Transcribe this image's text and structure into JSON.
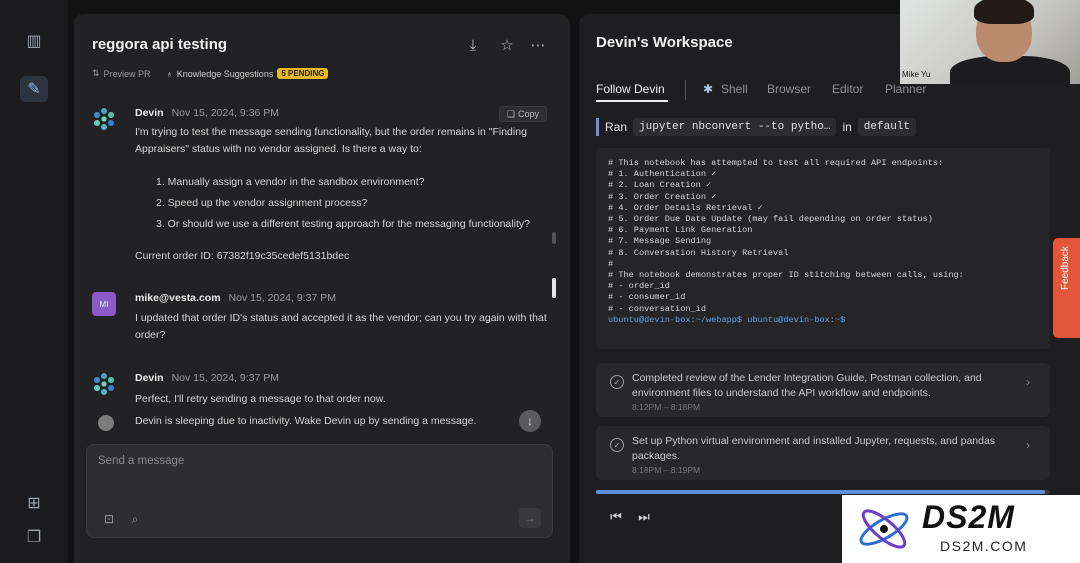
{
  "chat": {
    "title": "reggora api testing",
    "preview_pr": "Preview PR",
    "knowledge": "Knowledge Suggestions",
    "pending": "5 PENDING",
    "copy": "Copy",
    "messages": [
      {
        "name": "Devin",
        "date": "Nov 15, 2024, 9:36 PM",
        "text": "I'm trying to test the message sending functionality, but the order remains in \"Finding Appraisers\" status with no vendor assigned. Is there a way to:",
        "list": [
          "1.  Manually assign a vendor in the sandbox environment?",
          "2.  Speed up the vendor assignment process?",
          "3.  Or should we use a different testing approach for the messaging functionality?"
        ],
        "order": "Current order ID: 67382f19c35cedef5131bdec"
      },
      {
        "avatar": "MI",
        "name": "mike@vesta.com",
        "date": "Nov 15, 2024, 9:37 PM",
        "text": "I updated that order ID's status and accepted it as the vendor; can you try again with that order?"
      },
      {
        "name": "Devin",
        "date": "Nov 15, 2024, 9:37 PM",
        "text": "Perfect, I'll retry sending a message to that order now."
      }
    ],
    "sleeping": "Devin is sleeping due to inactivity. Wake Devin up by sending a message.",
    "input_placeholder": "Send a message"
  },
  "workspace": {
    "title": "Devin's Workspace",
    "tabs": [
      "Follow Devin",
      "Shell",
      "Browser",
      "Editor",
      "Planner"
    ],
    "ran": {
      "prefix": "Ran",
      "command": "jupyter nbconvert --to pytho…",
      "suffix": "in",
      "env": "default"
    },
    "terminal": {
      "lines": [
        "# This notebook has attempted to test all required API endpoints:",
        "# 1. Authentication ✓",
        "# 2. Loan Creation ✓",
        "# 3. Order Creation ✓",
        "# 4. Order Details Retrieval ✓",
        "# 5. Order Due Date Update (may fail depending on order status)",
        "# 6. Payment Link Generation",
        "# 7. Message Sending",
        "# 8. Conversation History Retrieval",
        "#",
        "# The notebook demonstrates proper ID stitching between calls, using:",
        "# - order_id",
        "# - consumer_id",
        "# - conversation_id"
      ],
      "prompt": "ubuntu@devin-box:~/webapp$ ubuntu@devin-box:~$"
    },
    "steps": [
      {
        "text": "Completed review of the Lender Integration Guide, Postman collection, and environment files to understand the API workflow and endpoints.",
        "time": "8:12PM – 8:18PM"
      },
      {
        "text": "Set up Python virtual environment and installed Jupyter, requests, and pandas packages.",
        "time": "8:18PM – 8:19PM"
      }
    ],
    "progress": 0.99
  },
  "camera": {
    "name": "Mike Yu"
  },
  "feedback": "Feedback",
  "watermark": {
    "big": "DS2M",
    "small": "DS2M.COM"
  }
}
